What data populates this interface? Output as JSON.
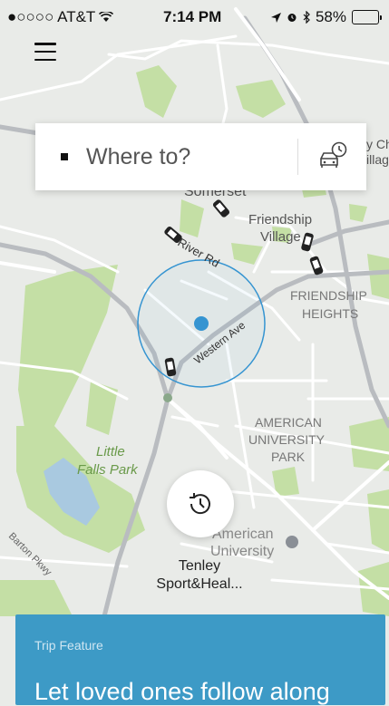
{
  "status_bar": {
    "carrier": "●○○○○ AT&T",
    "time": "7:14 PM",
    "battery": "58%",
    "battery_level": 0.58,
    "battery_color": "#f7c600"
  },
  "header": {
    "menu_icon": "hamburger-menu-icon"
  },
  "search": {
    "placeholder": "Where to?",
    "schedule_icon": "car-clock-icon"
  },
  "map": {
    "labels": {
      "somerset": "Somerset",
      "friendship_village": [
        "Friendship",
        "Village"
      ],
      "river_rd": "River Rd",
      "western_ave": "Western Ave",
      "friendship_heights": [
        "FRIENDSHIP",
        "HEIGHTS"
      ],
      "american_university_park": [
        "AMERICAN",
        "UNIVERSITY",
        "PARK"
      ],
      "little_falls_park": [
        "Little",
        "Falls Park"
      ],
      "american_university": [
        "American",
        "University"
      ],
      "barton_pkwy": "Barton Pkwy",
      "chevy_chase_partial": [
        "y Ch",
        "illag"
      ]
    },
    "colors": {
      "background": "#e9ebe8",
      "park": "#c4dfa5",
      "water": "#a9c9e0",
      "road": "#ffffff",
      "major_road": "#b9bcc0",
      "location": "#3594d1"
    }
  },
  "history": {
    "icon": "history-clock-icon"
  },
  "destination": {
    "line1": "Tenley",
    "line2": "Sport&Heal..."
  },
  "trip_card": {
    "eyebrow": "Trip Feature",
    "title": "Let loved ones follow along"
  }
}
